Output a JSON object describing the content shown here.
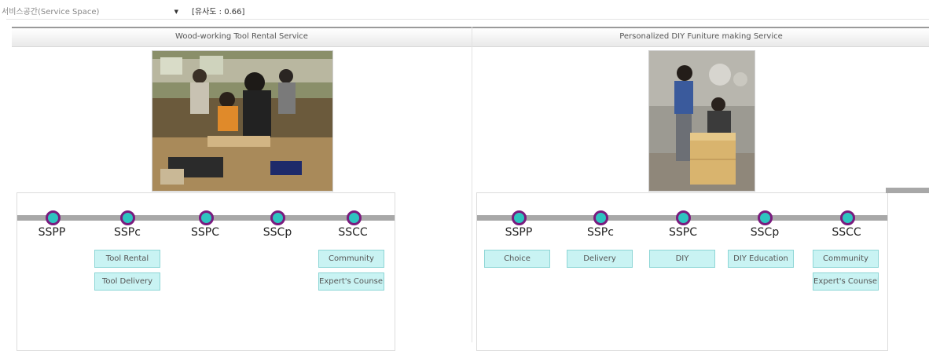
{
  "toolbar": {
    "space_select": "서비스공간(Service Space)",
    "similarity_label": "[유사도 : 0.66]"
  },
  "panels": [
    {
      "title": "Wood-working Tool Rental Service",
      "photo": "woodworking-workshop-photo",
      "stages": [
        "SSPP",
        "SSPc",
        "SSPC",
        "SSCp",
        "SSCC"
      ],
      "chips": {
        "SSPc": [
          "Tool Rental",
          "Tool Delivery"
        ],
        "SSCC": [
          "Community",
          "Expert's Counsel"
        ]
      }
    },
    {
      "title": "Personalized DIY Funiture making Service",
      "photo": "diy-furniture-photo",
      "stages": [
        "SSPP",
        "SSPc",
        "SSPC",
        "SSCp",
        "SSCC"
      ],
      "chips": {
        "SSPP": [
          "Choice"
        ],
        "SSPc": [
          "Delivery"
        ],
        "SSPC": [
          "DIY"
        ],
        "SSCp": [
          "DIY Education"
        ],
        "SSCC": [
          "Community",
          "Expert's Counsel"
        ]
      }
    }
  ],
  "colors": {
    "node_fill": "#2ec4c0",
    "node_ring": "#7a1a7e",
    "chip_bg": "#c9f3f3",
    "timeline": "#a8a8a8"
  }
}
